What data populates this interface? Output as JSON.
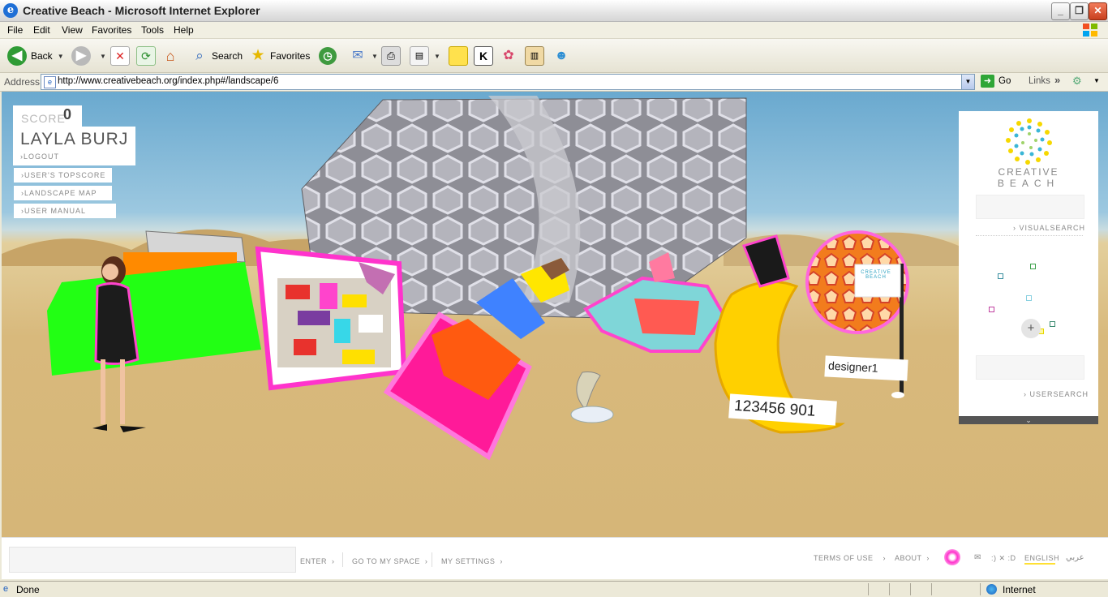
{
  "window": {
    "title": "Creative Beach - Microsoft Internet Explorer"
  },
  "menu": [
    "File",
    "Edit",
    "View",
    "Favorites",
    "Tools",
    "Help"
  ],
  "toolbar": {
    "back": "Back",
    "search": "Search",
    "favorites": "Favorites"
  },
  "address": {
    "label": "Address",
    "url": "http://www.creativebeach.org/index.php#/landscape/6",
    "go": "Go",
    "links": "Links"
  },
  "user_panel": {
    "score_label": "SCORE",
    "score_value": "0",
    "username": "LAYLA BURJ",
    "logout": "LOGOUT",
    "nav": [
      "USER'S TOPSCORE",
      "LANDSCAPE MAP",
      "USER MANUAL"
    ]
  },
  "right_panel": {
    "logo_line1": "CREATIVE",
    "logo_line2": "BEACH",
    "visualsearch": "VISUALSEARCH",
    "usersearch": "USERSEARCH"
  },
  "scene": {
    "designer_label": "designer1",
    "number_tag": "123456  901",
    "flag_text": "CREATIVE BEACH"
  },
  "footer": {
    "enter": "ENTER",
    "go_to_my_space": "GO TO MY SPACE",
    "my_settings": "MY SETTINGS",
    "terms": "TERMS OF USE",
    "about": "ABOUT",
    "emotes": ":) ✕ :D",
    "english": "ENGLISH",
    "arabic": "عربي"
  },
  "status": {
    "text": "Done",
    "zone": "Internet"
  },
  "colors": {
    "accent_pink": "#ff33cc",
    "lang_underline": "#ffe033",
    "ie_blue": "#1f6fd6"
  }
}
